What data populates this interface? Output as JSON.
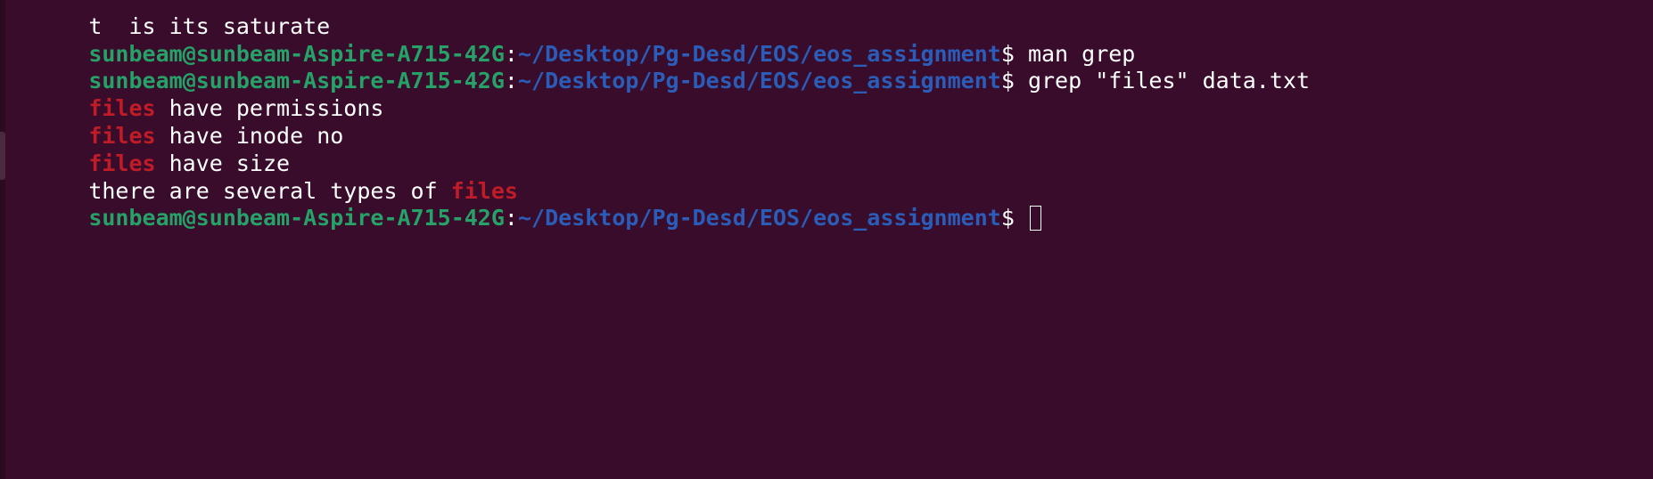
{
  "terminal": {
    "user_host": "sunbeam@sunbeam-Aspire-A715-42G",
    "colon": ":",
    "path": "~/Desktop/Pg-Desd/EOS/eos_assignment",
    "prompt_symbol": "$ ",
    "partial_top_line": "t  is its saturate",
    "commands": {
      "first": "man grep",
      "second": "grep \"files\" data.txt"
    },
    "output": [
      {
        "match": "files",
        "rest": " have permissions"
      },
      {
        "match": "files",
        "rest": " have inode no"
      },
      {
        "match": "files",
        "rest": " have size"
      },
      {
        "prefix": "there are several types of ",
        "match": "files"
      }
    ]
  },
  "colors": {
    "background": "#380c2a",
    "user_host": "#26a269",
    "path": "#2a5cb8",
    "match": "#c01c28",
    "text": "#ffffff"
  }
}
